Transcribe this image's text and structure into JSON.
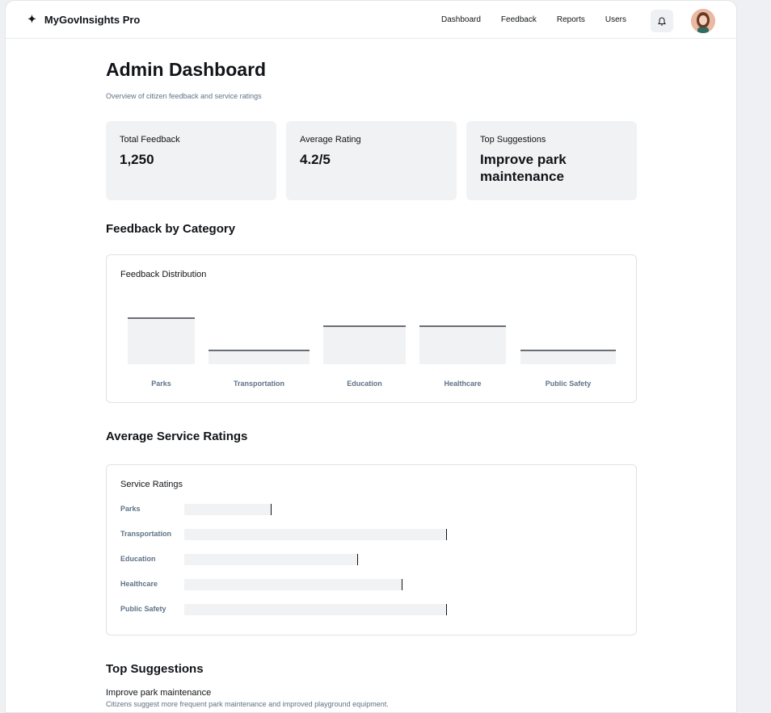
{
  "app": {
    "name": "MyGovInsights Pro",
    "nav": [
      "Dashboard",
      "Feedback",
      "Reports",
      "Users"
    ]
  },
  "page": {
    "title": "Admin Dashboard",
    "subtitle": "Overview of citizen feedback and service ratings"
  },
  "stats": [
    {
      "label": "Total Feedback",
      "value": "1,250"
    },
    {
      "label": "Average Rating",
      "value": "4.2/5"
    },
    {
      "label": "Top Suggestions",
      "value": "Improve park maintenance"
    }
  ],
  "category_section": {
    "heading": "Feedback by Category",
    "card_title": "Feedback Distribution"
  },
  "ratings_section": {
    "heading": "Average Service Ratings",
    "card_title": "Service Ratings"
  },
  "suggestions_section": {
    "heading": "Top Suggestions",
    "items": [
      {
        "title": "Improve park maintenance",
        "description": "Citizens suggest more frequent park maintenance and improved playground equipment."
      }
    ]
  },
  "icons": {
    "logo": "sparkle-icon",
    "notifications": "bell-icon"
  },
  "colors": {
    "card_bg": "#f0f2f4",
    "muted_text": "#5f7288",
    "bar_line": "#6b6f75"
  },
  "chart_data": [
    {
      "type": "bar",
      "title": "Feedback Distribution",
      "categories": [
        "Parks",
        "Transportation",
        "Education",
        "Healthcare",
        "Public Safety"
      ],
      "values": [
        58,
        18,
        48,
        48,
        18
      ],
      "ylim": [
        0,
        100
      ]
    },
    {
      "type": "bar",
      "orientation": "horizontal",
      "title": "Service Ratings",
      "categories": [
        "Parks",
        "Transportation",
        "Education",
        "Healthcare",
        "Public Safety"
      ],
      "values": [
        33,
        100,
        66,
        83,
        100
      ],
      "xlim": [
        0,
        100
      ]
    }
  ]
}
